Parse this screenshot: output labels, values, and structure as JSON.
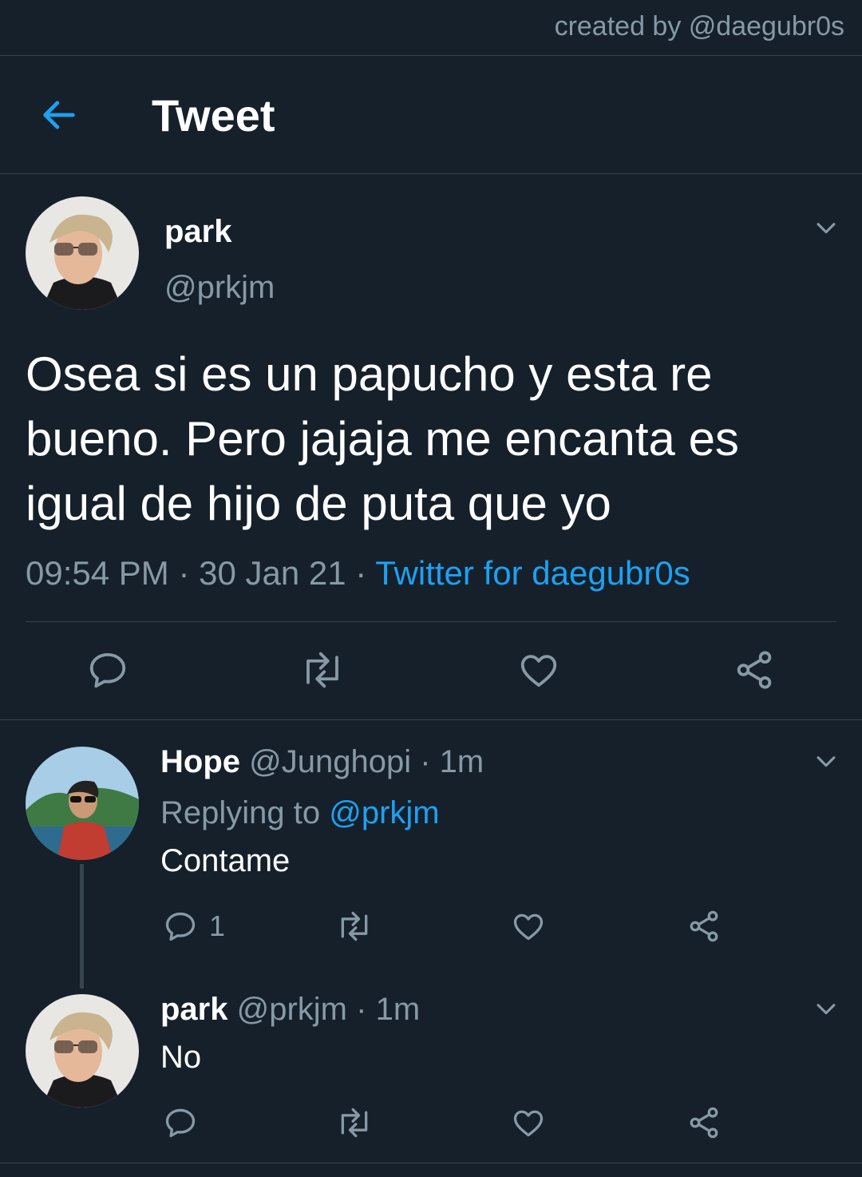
{
  "watermark": "created by @daegubr0s",
  "header": {
    "title": "Tweet"
  },
  "main_tweet": {
    "name": "park",
    "handle": "@prkjm",
    "text": "Osea si es un papucho y esta re bueno. Pero jajaja me encanta es igual de hijo de puta que yo",
    "time": "09:54 PM",
    "sep1": "·",
    "date": "30 Jan 21",
    "sep2": "·",
    "source": "Twitter for daegubr0s"
  },
  "replies": [
    {
      "name": "Hope",
      "handle": "@Junghopi",
      "dot": "·",
      "time": "1m",
      "replying_label": "Replying to",
      "replying_to": "@prkjm",
      "text": "Contame",
      "reply_count": "1"
    },
    {
      "name": "park",
      "handle": "@prkjm",
      "dot": "·",
      "time": "1m",
      "text": "No"
    }
  ],
  "colors": {
    "background": "#15202b",
    "accent": "#1da1f2",
    "muted": "#8899a6",
    "divider": "#38444d"
  },
  "icons": [
    "back-arrow-icon",
    "chevron-down-icon",
    "reply-icon",
    "retweet-icon",
    "like-icon",
    "share-icon"
  ]
}
